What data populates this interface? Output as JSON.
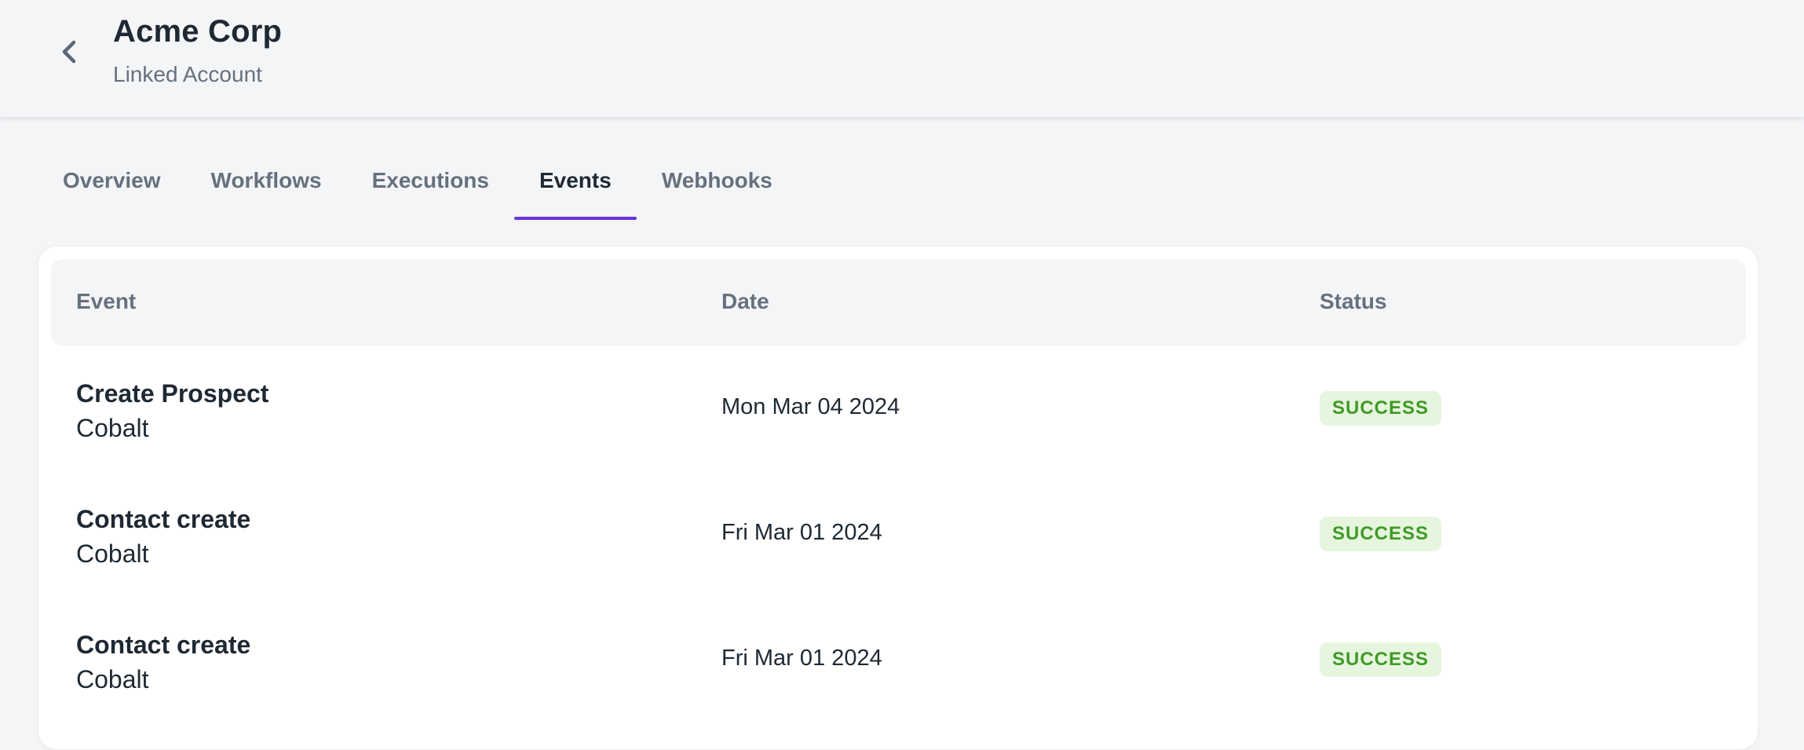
{
  "header": {
    "back_icon": "chevron-left-icon",
    "title": "Acme Corp",
    "subtitle": "Linked Account"
  },
  "tabs": [
    {
      "label": "Overview",
      "active": false
    },
    {
      "label": "Workflows",
      "active": false
    },
    {
      "label": "Executions",
      "active": false
    },
    {
      "label": "Events",
      "active": true
    },
    {
      "label": "Webhooks",
      "active": false
    }
  ],
  "table": {
    "columns": [
      "Event",
      "Date",
      "Status"
    ],
    "rows": [
      {
        "event": "Create Prospect",
        "source": "Cobalt",
        "date": "Mon Mar 04 2024",
        "status": "SUCCESS"
      },
      {
        "event": "Contact create",
        "source": "Cobalt",
        "date": "Fri Mar 01 2024",
        "status": "SUCCESS"
      },
      {
        "event": "Contact create",
        "source": "Cobalt",
        "date": "Fri Mar 01 2024",
        "status": "SUCCESS"
      }
    ]
  },
  "colors": {
    "accent": "#6a35d9",
    "success_bg": "#e6f5de",
    "success_text": "#3f9a26"
  }
}
